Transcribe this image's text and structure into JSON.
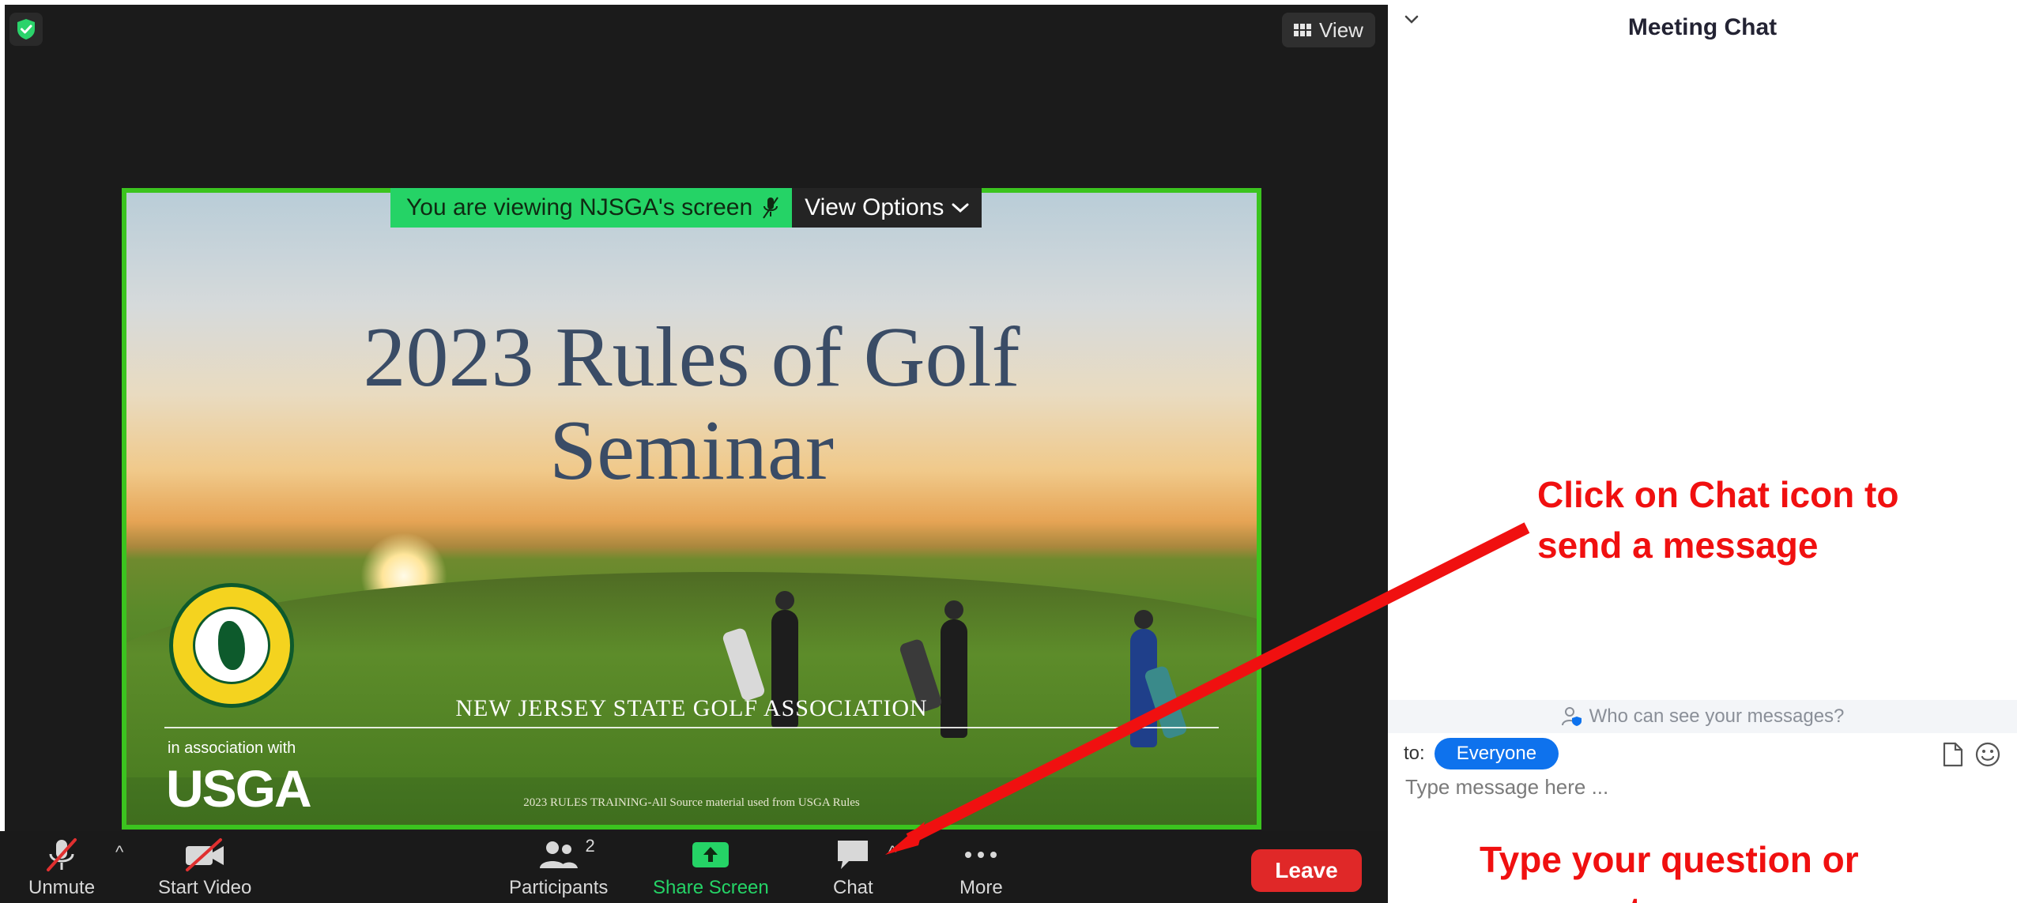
{
  "top": {
    "view_label": "View"
  },
  "slide": {
    "title_line1": "2023 Rules of Golf",
    "title_line2": "Seminar",
    "association_name": "NEW JERSEY STATE GOLF ASSOCIATION",
    "in_association_with": "in association with",
    "usga": "USGA",
    "footer_note": "2023 RULES TRAINING-All Source material used from USGA Rules"
  },
  "share_banner": {
    "viewing_text": "You are viewing NJSGA's screen",
    "view_options_label": "View Options"
  },
  "toolbar": {
    "unmute_label": "Unmute",
    "start_video_label": "Start Video",
    "participants_label": "Participants",
    "participants_count": "2",
    "share_screen_label": "Share Screen",
    "chat_label": "Chat",
    "more_label": "More",
    "leave_label": "Leave"
  },
  "chat": {
    "title": "Meeting Chat",
    "privacy_text": "Who can see your messages?",
    "to_label": "to:",
    "recipient": "Everyone",
    "input_placeholder": "Type message here ..."
  },
  "annotations": {
    "chat_hint_line1": "Click on Chat icon to",
    "chat_hint_line2": "send a message",
    "type_hint_line1": "Type your question or",
    "type_hint_line2": "comment"
  },
  "colors": {
    "share_green": "#25d366",
    "slide_border": "#3bc41f",
    "leave_red": "#e02828",
    "recipient_blue": "#0e72ed",
    "annotation_red": "#f01010"
  },
  "icons": {
    "security": "shield-check-icon",
    "view": "grid-icon",
    "unmute": "microphone-muted-icon",
    "start_video": "camera-off-icon",
    "participants": "people-icon",
    "share": "share-arrow-icon",
    "chat": "speech-bubble-icon",
    "more": "ellipsis-icon",
    "file": "file-icon",
    "emoji": "smiley-icon"
  }
}
